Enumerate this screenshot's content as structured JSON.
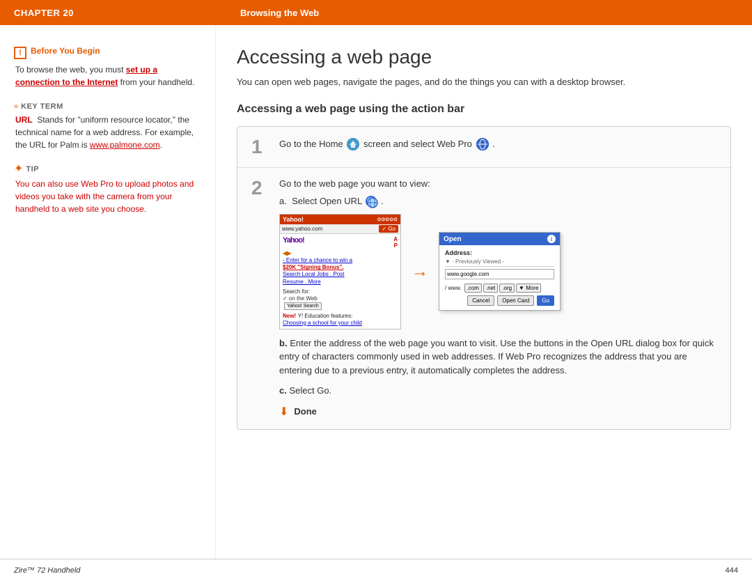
{
  "header": {
    "chapter_label": "CHAPTER 20",
    "section_title": "Browsing the Web"
  },
  "sidebar": {
    "before_begin": {
      "icon_label": "!",
      "heading": "Before You Begin",
      "text_parts": [
        "To browse the web, you must ",
        "set up a connection to the Internet",
        " from your handheld."
      ]
    },
    "key_term": {
      "chevron": "»",
      "heading": "Key Term",
      "url_label": "URL",
      "url_desc": "Stands for \"uniform resource locator,\" the technical name for a web address. For example, the URL for Palm is ",
      "url_link": "www.palmone.com",
      "url_end": "."
    },
    "tip": {
      "asterisk": "✦",
      "heading": "Tip",
      "text": "You can also use Web Pro to upload photos and videos you take with the camera from your handheld to a web site you choose."
    }
  },
  "main": {
    "page_title": "Accessing a web page",
    "intro": "You can open web pages, navigate the pages, and do the things you can with a desktop browser.",
    "section_title": "Accessing a web page using the action bar",
    "step1": {
      "number": "1",
      "text_before": "Go to the Home",
      "text_after": "screen and select Web Pro",
      "period": "."
    },
    "step2": {
      "number": "2",
      "text": "Go to the web page you want to view:",
      "sub_a_label": "a.",
      "sub_a_text": "Select Open URL",
      "phone_url": "www.yahoo.com",
      "phone_go": "Go",
      "phone_title": "Yahoo!",
      "phone_yahoo_logo": "Yahoo!",
      "phone_content": [
        "Enter for a chance to win a",
        "$20K \"Signing Bonus\".",
        "Search Local Jobs . Post",
        "Resume . More"
      ],
      "phone_search_label": "Search for:",
      "phone_search_on_web": "✓ on the Web",
      "phone_search_btn": "Yahoo! Search",
      "phone_new_label": "New!",
      "phone_new_text": "Y! Education features:",
      "phone_new_link": "Choosing a school for your child",
      "phone_col_labels": [
        "A",
        "P"
      ],
      "dialog_title": "Open",
      "dialog_info": "i",
      "dialog_address_label": "Address:",
      "dialog_prev": "▼  - Previously Viewed -",
      "dialog_url_val": "www.google.com",
      "dialog_prefixes": [
        "/ www.",
        ".com",
        ".net",
        ".org"
      ],
      "dialog_more": "▼ More",
      "dialog_cancel": "Cancel",
      "dialog_open_card": "Open Card",
      "dialog_go": "Go",
      "sub_b_label": "b.",
      "sub_b_text": "Enter the address of the web page you want to visit. Use the buttons in the Open URL dialog box for quick entry of characters commonly used in web addresses. If Web Pro recognizes the address that you are entering due to a previous entry, it automatically completes the address.",
      "sub_c_label": "c.",
      "sub_c_text": "Select Go.",
      "done_arrow": "⬇",
      "done_label": "Done"
    }
  },
  "footer": {
    "left": "Zire™ 72 Handheld",
    "right": "444"
  }
}
